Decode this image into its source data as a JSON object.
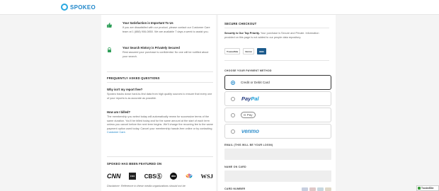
{
  "header": {
    "logo_text": "SPOKEO"
  },
  "notes": [
    {
      "title": "Your Satisfaction is Important To Us",
      "body": "If you are dissatisfied with our product, please contact our Customer Care team at 1 (888) 906-0850. We are available 7 days a week to assist you.",
      "icon": "thumbs-up-icon"
    },
    {
      "title": "Your Search History is Privately Secured",
      "body": "Rest assured your purchase is confidential. No one will be notified about your search.",
      "icon": "lock-icon"
    }
  ],
  "faq": {
    "heading": "FREQUENTLY ASKED QUESTIONS",
    "items": [
      {
        "q": "Why isn't my report free?",
        "a": "Spokeo tracks down hard-to-find data from high quality sources to ensure that every one of your reports is as accurate as possible."
      },
      {
        "q": "How am I billed?",
        "a": "The membership you select today will automatically renew for successive terms of the same duration. You'll be billed today and for the same amount at the start of each term unless you cancel before the next term begins. We'll charge the recurring fee to the same payment option used today. Cancel your membership hassle-free online or by contacting ",
        "link": "Customer Care."
      }
    ]
  },
  "featured": {
    "heading": "SPOKEO HAS BEEN FEATURED ON",
    "outlets": [
      "CNN",
      "FOX",
      "CBSⓈ",
      "abc",
      "NBC",
      "WSJ"
    ],
    "disclaimer": "Disclaimer: Reference to these media organizations should not be"
  },
  "checkout": {
    "heading": "SECURE CHECKOUT",
    "security_bold": "Security is Our Top Priority.",
    "security_text": " Your purchase is Secure and Private. Information provided on this page is not added to our people data repository.",
    "badges": [
      "TrustedSite",
      "Norton",
      "BBB"
    ],
    "payment_heading": "CHOOSE YOUR PAYMENT METHOD",
    "methods": [
      {
        "label": "Credit or Debit Card",
        "selected": true
      },
      {
        "label_a": "Pay",
        "label_b": "Pal"
      },
      {
        "label": "G Pay"
      },
      {
        "label": "venmo"
      }
    ],
    "email_label": "EMAIL (THIS WILL BE YOUR LOGIN)",
    "name_label": "NAME ON CARD",
    "card_label": "CARD NUMBER"
  },
  "trusted_badge": "TrustedSite",
  "colors": {
    "accent": "#1f86c9",
    "paypal_dark": "#253b80",
    "paypal_light": "#179bd7",
    "venmo": "#3d95ce",
    "green": "#2e9e58"
  }
}
